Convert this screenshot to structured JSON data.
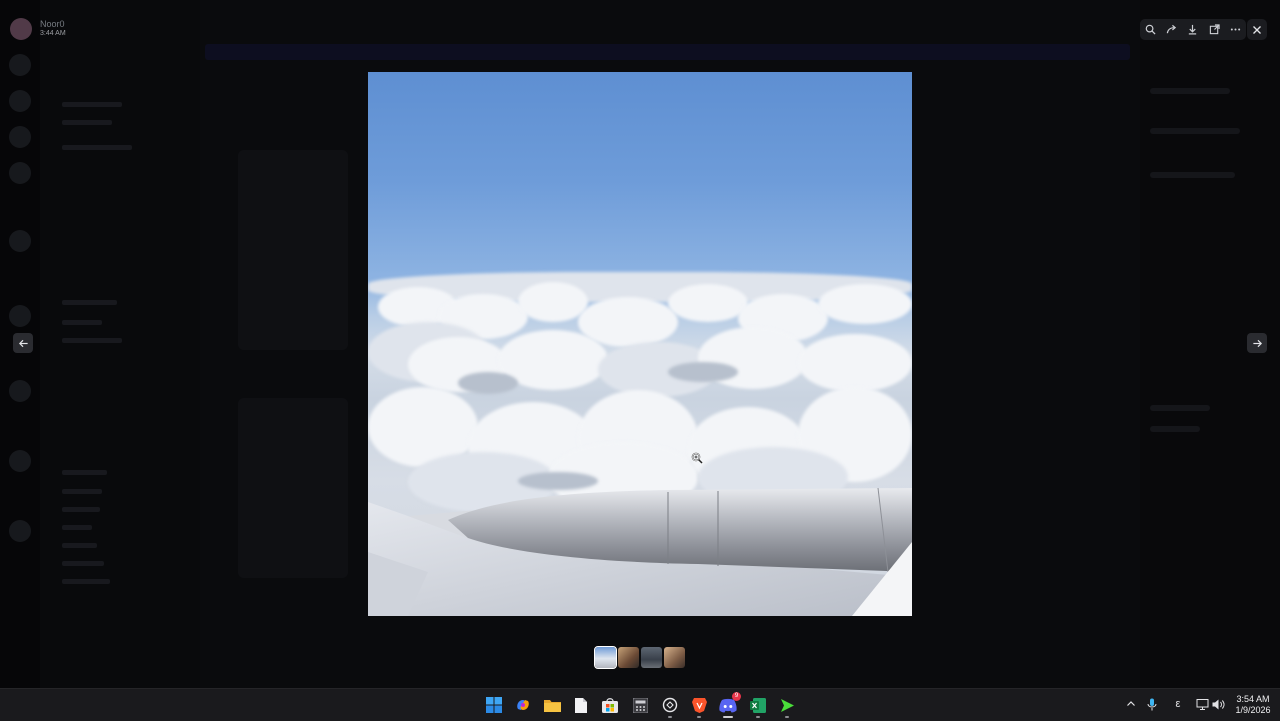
{
  "background_app": {
    "user_name": "Noor0",
    "user_status_time": "3:44 AM"
  },
  "viewer": {
    "toolbar_icons": [
      "zoom-icon",
      "forward-icon",
      "download-icon",
      "open-external-icon",
      "more-icon"
    ],
    "close_icon": "close-icon",
    "prev_icon": "arrow-left-icon",
    "next_icon": "arrow-right-icon",
    "image_description_icon": "photo",
    "thumbnail_count": 4
  },
  "taskbar": {
    "apps": [
      "start",
      "copilot",
      "file-explorer",
      "notepad",
      "store",
      "calculator",
      "chatgpt",
      "brave",
      "discord",
      "excel",
      "terminal"
    ],
    "discord_badge": "9",
    "clock": {
      "time": "3:54 AM",
      "date": "1/9/2026"
    },
    "tray": {
      "language": "ε"
    }
  },
  "colors": {
    "backdrop": "#050506",
    "accent": "#5865f2",
    "sky": "#6e9cd9"
  }
}
